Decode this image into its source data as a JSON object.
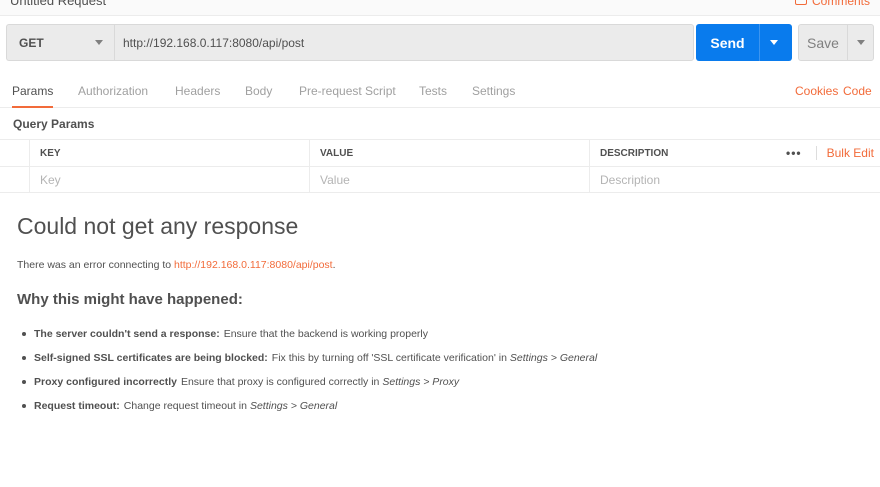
{
  "header": {
    "title": "Untitled Request",
    "comments_label": "Comments"
  },
  "request": {
    "method": "GET",
    "url": "http://192.168.0.117:8080/api/post",
    "send_label": "Send",
    "save_label": "Save"
  },
  "tabs": {
    "items": [
      {
        "label": "Params"
      },
      {
        "label": "Authorization"
      },
      {
        "label": "Headers"
      },
      {
        "label": "Body"
      },
      {
        "label": "Pre-request Script"
      },
      {
        "label": "Tests"
      },
      {
        "label": "Settings"
      }
    ],
    "active": "Params",
    "cookies_label": "Cookies",
    "code_label": "Code"
  },
  "params": {
    "section_title": "Query Params",
    "columns": [
      "KEY",
      "VALUE",
      "DESCRIPTION"
    ],
    "placeholders": [
      "Key",
      "Value",
      "Description"
    ],
    "more_label": "•••",
    "bulk_edit_label": "Bulk Edit"
  },
  "response": {
    "title": "Could not get any response",
    "error_prefix": "There was an error connecting to ",
    "error_link": "http://192.168.0.117:8080/api/post",
    "error_suffix": ".",
    "why_title": "Why this might have happened:",
    "reasons": [
      {
        "bold": "The server couldn't send a response:",
        "text": "Ensure that the backend is working properly",
        "italic": ""
      },
      {
        "bold": "Self-signed SSL certificates are being blocked:",
        "text": "Fix this by turning off 'SSL certificate verification' in",
        "italic": "Settings > General"
      },
      {
        "bold": "Proxy configured incorrectly",
        "text": "Ensure that proxy is configured correctly in",
        "italic": "Settings > Proxy"
      },
      {
        "bold": "Request timeout:",
        "text": "Change request timeout in",
        "italic": "Settings > General"
      }
    ]
  },
  "colors": {
    "accent": "#f26b3a",
    "send": "#097bed"
  }
}
